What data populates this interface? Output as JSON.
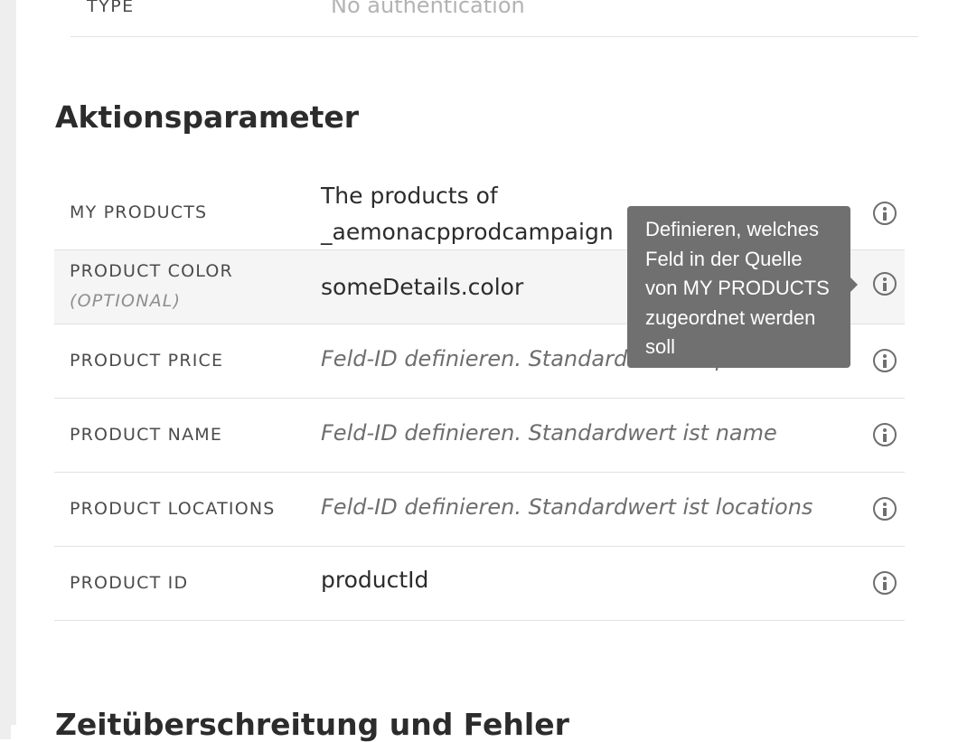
{
  "auth": {
    "label": "TYPE",
    "value": "No authentication"
  },
  "sections": {
    "params_title": "Aktionsparameter",
    "timeout_title": "Zeitüberschreitung und Fehler"
  },
  "params": [
    {
      "label": "MY PRODUCTS",
      "value_line1": "The products of",
      "value_line2": "_aemonacpprodcampaign"
    },
    {
      "label": "PRODUCT COLOR",
      "sublabel": "(OPTIONAL)",
      "value": "someDetails.color"
    },
    {
      "label": "PRODUCT PRICE",
      "placeholder": "Feld-ID definieren. Standardwert ist price"
    },
    {
      "label": "PRODUCT NAME",
      "placeholder": "Feld-ID definieren. Standardwert ist name"
    },
    {
      "label": "PRODUCT LOCATIONS",
      "placeholder": "Feld-ID definieren. Standardwert ist locations"
    },
    {
      "label": "PRODUCT ID",
      "value": "productId"
    }
  ],
  "tooltip": {
    "text": "Definieren, welches Feld in der Quelle von MY PRODUCTS zugeordnet werden soll"
  },
  "icons": {
    "info": "info-icon"
  },
  "colors": {
    "tooltip_bg": "#707070",
    "row_highlight": "#f5f5f5",
    "divider": "#e1e1e1"
  }
}
